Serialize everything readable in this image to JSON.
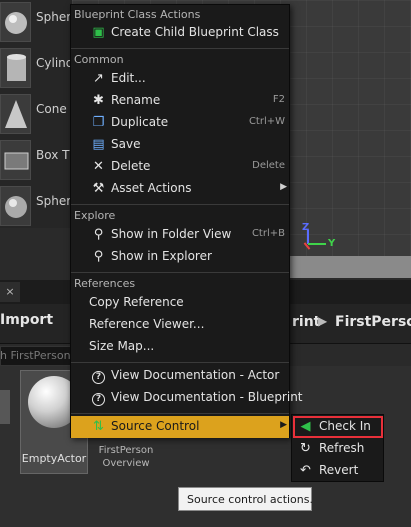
{
  "place_actors": [
    {
      "label": "Spher",
      "icon": "sphere-icon"
    },
    {
      "label": "Cylind",
      "icon": "cylinder-icon"
    },
    {
      "label": "Cone",
      "icon": "cone-icon"
    },
    {
      "label": "Box T",
      "icon": "box-trigger-icon"
    },
    {
      "label": "Spher",
      "icon": "sphere-icon"
    }
  ],
  "viewport": {
    "axis_z": "Z",
    "axis_y": "Y"
  },
  "content_browser": {
    "tab_close": "×",
    "import_label": "Import",
    "breadcrumb_1": "rint",
    "breadcrumb_sep": "▶",
    "breadcrumb_2": "FirstPerson",
    "search_text": "h FirstPerson",
    "asset_name": "EmptyActor",
    "folder_label": "FirstPerson Overview"
  },
  "context_menu": {
    "sections": {
      "blueprint_class_actions": "Blueprint Class Actions",
      "common": "Common",
      "explore": "Explore",
      "references": "References"
    },
    "items": {
      "create_child": {
        "label": "Create Child Blueprint Class",
        "icon": "blueprint-icon"
      },
      "edit": {
        "label": "Edit...",
        "icon": "edit-icon"
      },
      "rename": {
        "label": "Rename",
        "shortcut": "F2",
        "icon": "rename-icon"
      },
      "duplicate": {
        "label": "Duplicate",
        "shortcut": "Ctrl+W",
        "icon": "duplicate-icon"
      },
      "save": {
        "label": "Save",
        "icon": "save-icon"
      },
      "delete": {
        "label": "Delete",
        "shortcut": "Delete",
        "icon": "delete-icon"
      },
      "asset_actions": {
        "label": "Asset Actions",
        "icon": "wrench-icon"
      },
      "show_in_folder": {
        "label": "Show in Folder View",
        "shortcut": "Ctrl+B",
        "icon": "magnifier-icon"
      },
      "show_in_explorer": {
        "label": "Show in Explorer",
        "icon": "magnifier-icon"
      },
      "copy_reference": {
        "label": "Copy Reference"
      },
      "reference_viewer": {
        "label": "Reference Viewer..."
      },
      "size_map": {
        "label": "Size Map..."
      },
      "view_doc_actor": {
        "label": "View Documentation - Actor",
        "icon": "help-icon"
      },
      "view_doc_blueprint": {
        "label": "View Documentation - Blueprint",
        "icon": "help-icon"
      },
      "source_control": {
        "label": "Source Control",
        "icon": "source-control-icon"
      }
    }
  },
  "source_control_submenu": {
    "check_in": "Check In",
    "refresh": "Refresh",
    "revert": "Revert"
  },
  "tooltip": "Source control actions.",
  "colors": {
    "highlight": "#dca21d",
    "focus_frame": "#e8303a"
  }
}
